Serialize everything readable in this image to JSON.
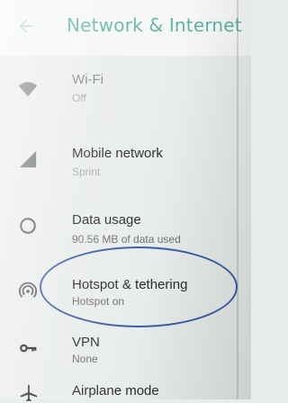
{
  "header": {
    "title": "Network & Internet",
    "back_icon": "arrow-left-icon"
  },
  "items": [
    {
      "label": "Wi-Fi",
      "sub": "Off",
      "icon": "wifi-icon"
    },
    {
      "label": "Mobile network",
      "sub": "Sprint",
      "icon": "signal-icon"
    },
    {
      "label": "Data usage",
      "sub": "90.56 MB of data used",
      "icon": "data-usage-icon"
    },
    {
      "label": "Hotspot & tethering",
      "sub": "Hotspot on",
      "icon": "hotspot-icon"
    },
    {
      "label": "VPN",
      "sub": "None",
      "icon": "vpn-key-icon"
    },
    {
      "label": "Airplane mode",
      "sub": "",
      "icon": "airplane-icon"
    }
  ],
  "colors": {
    "accent": "#5fb2a3",
    "annotation_circle": "#3b5ea8"
  }
}
